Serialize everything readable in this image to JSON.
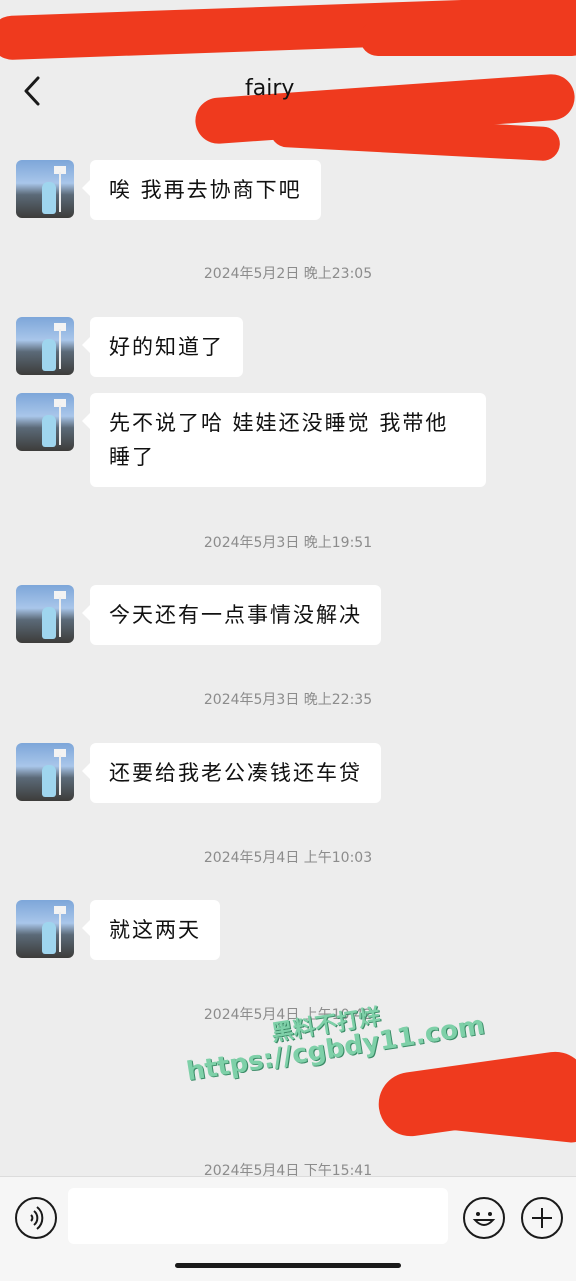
{
  "header": {
    "title": "fairy",
    "back_icon": "chevron-left-icon",
    "heart_icon": "blue-heart-icon"
  },
  "messages": [
    {
      "text": "唉 我再去协商下吧"
    },
    {
      "timestamp": "2024年5月2日 晚上23:05"
    },
    {
      "text": "好的知道了"
    },
    {
      "text": "先不说了哈 娃娃还没睡觉 我带他睡了"
    },
    {
      "timestamp": "2024年5月3日 晚上19:51"
    },
    {
      "text": "今天还有一点事情没解决"
    },
    {
      "timestamp": "2024年5月3日 晚上22:35"
    },
    {
      "text": "还要给我老公凑钱还车贷"
    },
    {
      "timestamp": "2024年5月4日 上午10:03"
    },
    {
      "text": "就这两天"
    },
    {
      "timestamp": "2024年5月4日 上午10:42"
    },
    {
      "timestamp": "2024年5月4日 下午15:41"
    }
  ],
  "watermark": {
    "line1": "黑料不打烊",
    "line2": "https://cgbdy11.com"
  },
  "input_bar": {
    "voice_icon": "voice-icon",
    "emoji_icon": "emoji-icon",
    "plus_icon": "plus-icon"
  },
  "colors": {
    "background": "#ededed",
    "bubble": "#ffffff",
    "timestamp": "#8c8c8c",
    "redaction": "#ef3a1e"
  }
}
